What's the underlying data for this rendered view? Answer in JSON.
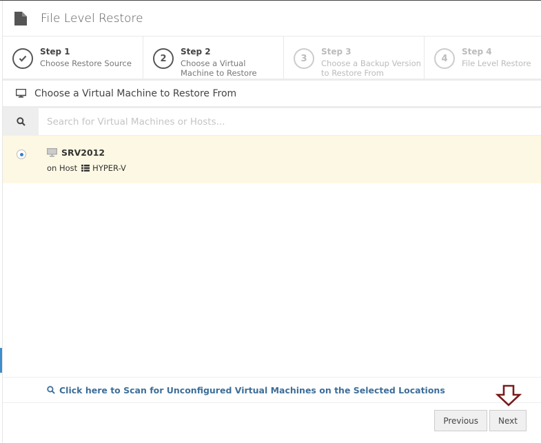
{
  "header": {
    "title": "File Level Restore",
    "icon": "file-icon"
  },
  "steps": [
    {
      "number": "✔",
      "label": "Step 1",
      "description": "Choose Restore Source",
      "state": "completed"
    },
    {
      "number": "2",
      "label": "Step 2",
      "description": "Choose a Virtual Machine to Restore",
      "state": "active"
    },
    {
      "number": "3",
      "label": "Step 3",
      "description": "Choose a Backup Version to Restore From",
      "state": "inactive"
    },
    {
      "number": "4",
      "label": "Step 4",
      "description": "File Level Restore",
      "state": "inactive"
    }
  ],
  "section": {
    "title": "Choose a Virtual Machine to Restore From"
  },
  "search": {
    "placeholder": "Search for Virtual Machines or Hosts...",
    "value": ""
  },
  "vms": [
    {
      "name": "SRV2012",
      "host_prefix": "on Host",
      "host": "HYPER-V",
      "selected": true
    }
  ],
  "scan": {
    "label": "Click here to Scan for Unconfigured Virtual Machines on the Selected Locations"
  },
  "footer": {
    "previous_label": "Previous",
    "next_label": "Next"
  },
  "colors": {
    "accent": "#3c8dca",
    "selected_row": "#fcf8e3",
    "link": "#3d6e99",
    "annotation_arrow": "#7a1a1a"
  }
}
